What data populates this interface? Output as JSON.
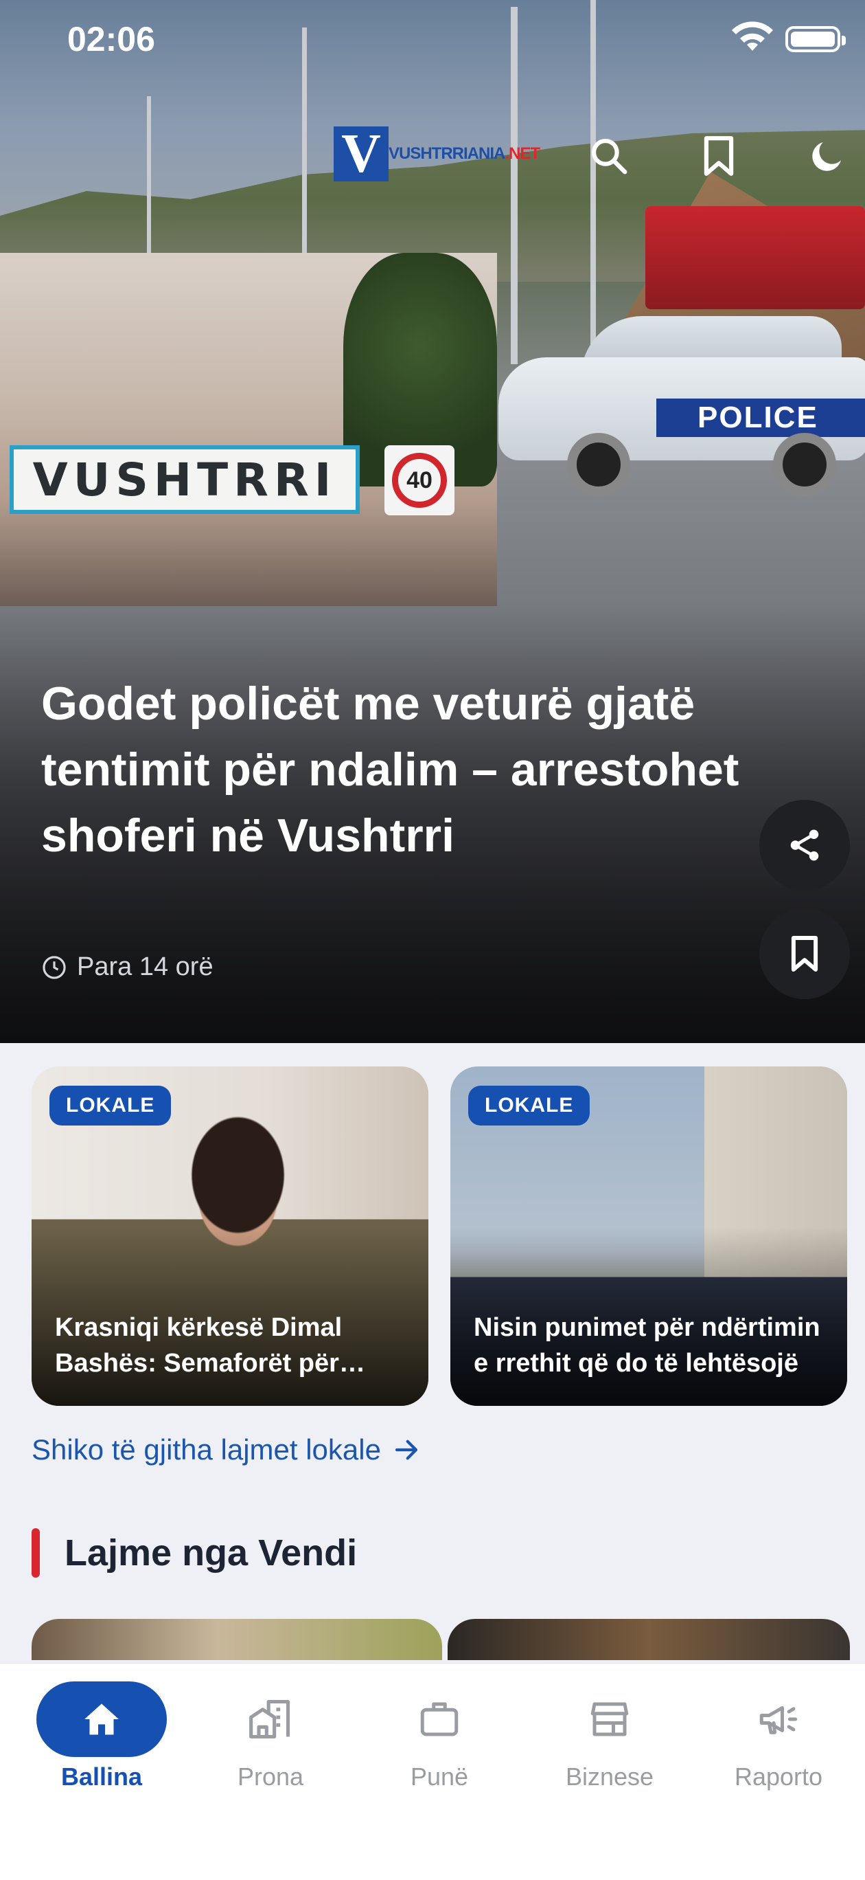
{
  "status_bar": {
    "time": "02:06"
  },
  "header": {
    "logo_letter": "V",
    "logo_text_main": "VUSHTRRIANIA",
    "logo_text_accent": ".NET",
    "icons": [
      "search-icon",
      "bookmark-icon",
      "moon-icon"
    ]
  },
  "hero": {
    "photo_sign_text": "VUSHTRRI",
    "photo_speed_limit": "40",
    "photo_car_text": "POLICE",
    "title": "Godet policët me veturë gjatë tentimit për ndalim – arrestohet shoferi në Vushtrri",
    "time_ago": "Para 14 orë"
  },
  "local_cards": [
    {
      "badge": "LOKALE",
      "title": "Krasniqi kërkesë Dimal Bashës: Semaforët për këmbësorët"
    },
    {
      "badge": "LOKALE",
      "title": "Nisin punimet për ndërtimin e rrethit që do të lehtësojë"
    }
  ],
  "see_all_label": "Shiko të gjitha lajmet lokale",
  "section_title": "Lajme nga Vendi",
  "bottom_nav": {
    "items": [
      {
        "label": "Ballina",
        "icon": "home-icon",
        "active": true
      },
      {
        "label": "Prona",
        "icon": "buildings-icon",
        "active": false
      },
      {
        "label": "Punë",
        "icon": "briefcase-icon",
        "active": false
      },
      {
        "label": "Biznese",
        "icon": "store-icon",
        "active": false
      },
      {
        "label": "Raporto",
        "icon": "megaphone-icon",
        "active": false
      }
    ]
  },
  "colors": {
    "accent": "#1650b0",
    "section_bar": "#d8262f",
    "background": "#eff0f6"
  }
}
